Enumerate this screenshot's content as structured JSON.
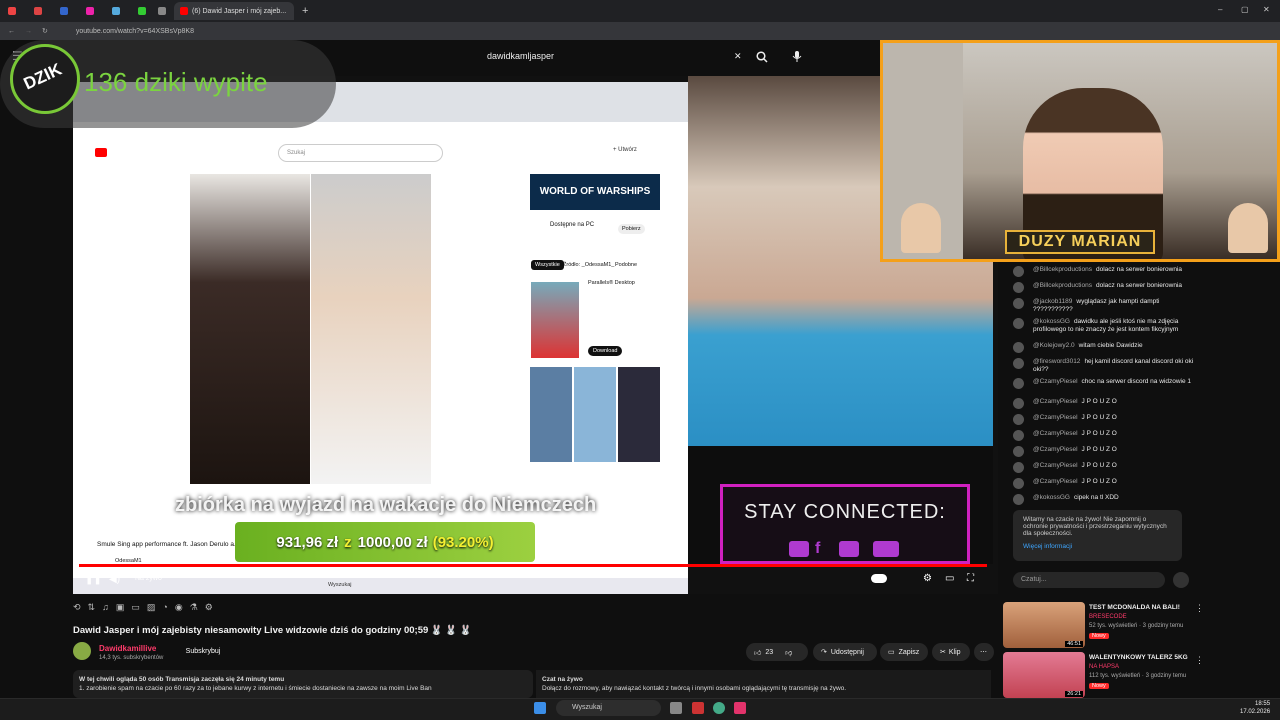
{
  "browser": {
    "active_tab": "(6) Dawid Jasper i mój zajeb...",
    "url": "youtube.com/watch?v=64XSBsVp8K8",
    "new_tab": "+",
    "win_min": "–",
    "win_max": "▢",
    "win_close": "✕"
  },
  "youtube": {
    "search_value": "dawidkamljasper",
    "clear": "✕"
  },
  "overlay": {
    "dzik_counter": "136 dziki wypite",
    "dzik_logo": "DZIK",
    "subtitle": "zbiórka na wyjazd na wakacje do Niemczech",
    "goal_current": "931,96 zł",
    "goal_sep": "z",
    "goal_target": "1000,00 zł",
    "goal_percent": "(93.20%)",
    "goal_fraction": 0.932,
    "stay_connected": "STAY CONNECTED:",
    "marian": "DUZY MARIAN",
    "live_label": "Na żywo"
  },
  "inner_browser": {
    "search_placeholder": "Szukaj",
    "create": "+ Utwórz",
    "ad_title": "WORLD OF WARSHIPS",
    "ad_sub": "Dostępne na PC",
    "ad_btn": "Pobierz",
    "chip_all": "Wszystkie",
    "chip_from": "Źródło: _OdessaM1_",
    "chip_similar": "Podobne",
    "parallels": "Parallels® Desktop",
    "download": "Download",
    "video_title": "Smule Sing app performance ft. Jason Derulo a...",
    "channel": "OdessaM1",
    "taskbar_search": "Wyszukaj"
  },
  "chat": {
    "messages": [
      {
        "user": "@Billcekproductions",
        "text": "dolacz na serwer bonierownia"
      },
      {
        "user": "@Billcekproductions",
        "text": "dolacz na serwer bonierownia"
      },
      {
        "user": "@jackob1189",
        "text": "wyglądasz jak hampti dampti ???????????"
      },
      {
        "user": "@kokossGG",
        "text": "dawidku ale jeśli ktoś nie ma zdjęcia profilowego to nie znaczy że jest kontem fikcyjnym"
      },
      {
        "user": "@Kolejowy2.0",
        "text": "witam ciebie Dawidzie"
      },
      {
        "user": "@firesword3012",
        "text": "hej kamil discord kanal discord oki oki oki??"
      },
      {
        "user": "@CzamyPiesel",
        "text": "choc na serwer discord na widzowie 1"
      },
      {
        "user": "@CzamyPiesel",
        "text": "J P O U Z O"
      },
      {
        "user": "@CzamyPiesel",
        "text": "J P O U Z O"
      },
      {
        "user": "@CzamyPiesel",
        "text": "J P O U Z O"
      },
      {
        "user": "@CzamyPiesel",
        "text": "J P O U Z O"
      },
      {
        "user": "@CzamyPiesel",
        "text": "J P O U Z O"
      },
      {
        "user": "@CzamyPiesel",
        "text": "J P O U Z O"
      },
      {
        "user": "@kokossGG",
        "text": "cipek na tl XDD"
      }
    ],
    "welcome": "Witamy na czacie na żywo! Nie zapomnij o ochronie prywatności i przestrzeganiu wytycznych dla społeczności.",
    "welcome_link": "Więcej informacji",
    "input_placeholder": "Czatuj..."
  },
  "video": {
    "title": "Dawid Jasper i mój zajebisty niesamowity Live widzowie dziś do godziny 00;59 🐰 🐰 🐰",
    "channel": "Dawidkamillive",
    "subscribers": "14,3 tys. subskrybentów",
    "subscribe": "Subskrybuj",
    "likes": "23",
    "share": "Udostępnij",
    "save": "Zapisz",
    "clip": "Klip",
    "more": "⋯",
    "desc_line1": "W tej chwili ogląda 50 osób  Transmisja zaczęła się 24 minuty temu",
    "desc_line2": "1. zarobienie spam na czacie po 60 razy za to jebane kurwy z internetu i śmiecie dostaniecie na zawsze na moim Live Ban",
    "livechat_title": "Czat na żywo",
    "livechat_line": "Dołącz do rozmowy, aby nawiązać kontakt z twórcą i innymi osobami oglądającymi tę transmisję na żywo."
  },
  "recommendations": [
    {
      "title": "TEST MCDONALDA NA BALI!",
      "channel": "BRESECODE",
      "meta": "52 tys. wyświetleń · 3 godziny temu",
      "badge": "Nowy",
      "duration": "46:51"
    },
    {
      "title": "WALENTYNKOWY TALERZ 5KG",
      "channel": "NA HAPSA",
      "meta": "112 tys. wyświetleń · 3 godziny temu",
      "badge": "Nowy",
      "duration": "26:21"
    }
  ],
  "taskbar": {
    "search": "Wyszukaj",
    "time": "18:55",
    "date": "17.02.2026"
  },
  "colors": {
    "accent_red": "#ff0000",
    "goal_green": "#7bd440",
    "stream_pink": "#d020c0",
    "facecam_orange": "#f4a01a"
  }
}
